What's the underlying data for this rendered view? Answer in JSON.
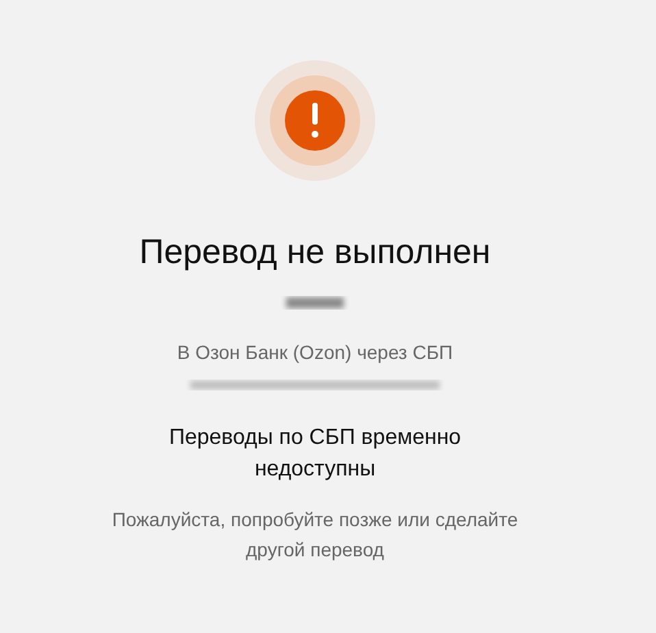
{
  "status": {
    "title": "Перевод не выполнен",
    "bank_line": "В Озон Банк (Ozon) через СБП"
  },
  "notice": {
    "heading": "Переводы по СБП временно недоступны",
    "message": "Пожалуйста, попробуйте позже или сделайте другой перевод"
  }
}
